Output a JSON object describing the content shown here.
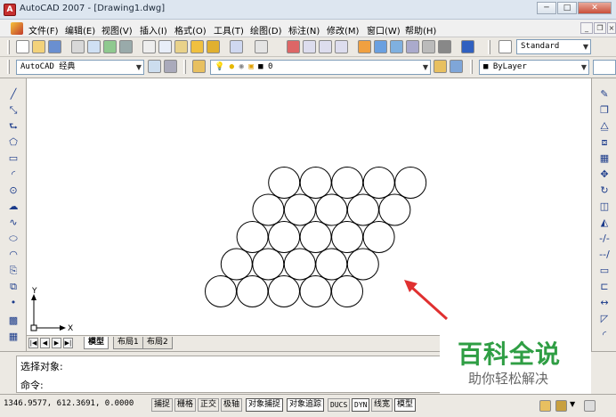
{
  "window": {
    "title": "AutoCAD 2007 - [Drawing1.dwg]",
    "app_icon": "autocad-logo-icon"
  },
  "menubar": {
    "items": [
      {
        "label": "文件(F)"
      },
      {
        "label": "编辑(E)"
      },
      {
        "label": "视图(V)"
      },
      {
        "label": "插入(I)"
      },
      {
        "label": "格式(O)"
      },
      {
        "label": "工具(T)"
      },
      {
        "label": "绘图(D)"
      },
      {
        "label": "标注(N)"
      },
      {
        "label": "修改(M)"
      },
      {
        "label": "窗口(W)"
      },
      {
        "label": "帮助(H)"
      }
    ]
  },
  "toolbar": {
    "text_style": "Standard",
    "workspace": "AutoCAD 经典",
    "layer": "0",
    "color": "ByLayer"
  },
  "canvas": {
    "ucs_x_label": "X",
    "ucs_y_label": "Y",
    "circle_rows": [
      5,
      5,
      5,
      5,
      5
    ],
    "arrow_color": "#e03030"
  },
  "tabs": [
    {
      "label": "模型",
      "active": true
    },
    {
      "label": "布局1",
      "active": false
    },
    {
      "label": "布局2",
      "active": false
    }
  ],
  "command": {
    "line1": "选择对象:",
    "line2": "命令:"
  },
  "status": {
    "coordinates": "1346.9577, 612.3691, 0.0000",
    "buttons": [
      {
        "label": "捕捉",
        "on": false
      },
      {
        "label": "栅格",
        "on": false
      },
      {
        "label": "正交",
        "on": false
      },
      {
        "label": "极轴",
        "on": false
      },
      {
        "label": "对象捕捉",
        "on": true
      },
      {
        "label": "对象追踪",
        "on": true
      },
      {
        "label": "DUCS",
        "on": false
      },
      {
        "label": "DYN",
        "on": true
      },
      {
        "label": "线宽",
        "on": false
      },
      {
        "label": "模型",
        "on": true
      }
    ]
  },
  "watermark": {
    "title": "百科全说",
    "subtitle": "助你轻松解决"
  }
}
